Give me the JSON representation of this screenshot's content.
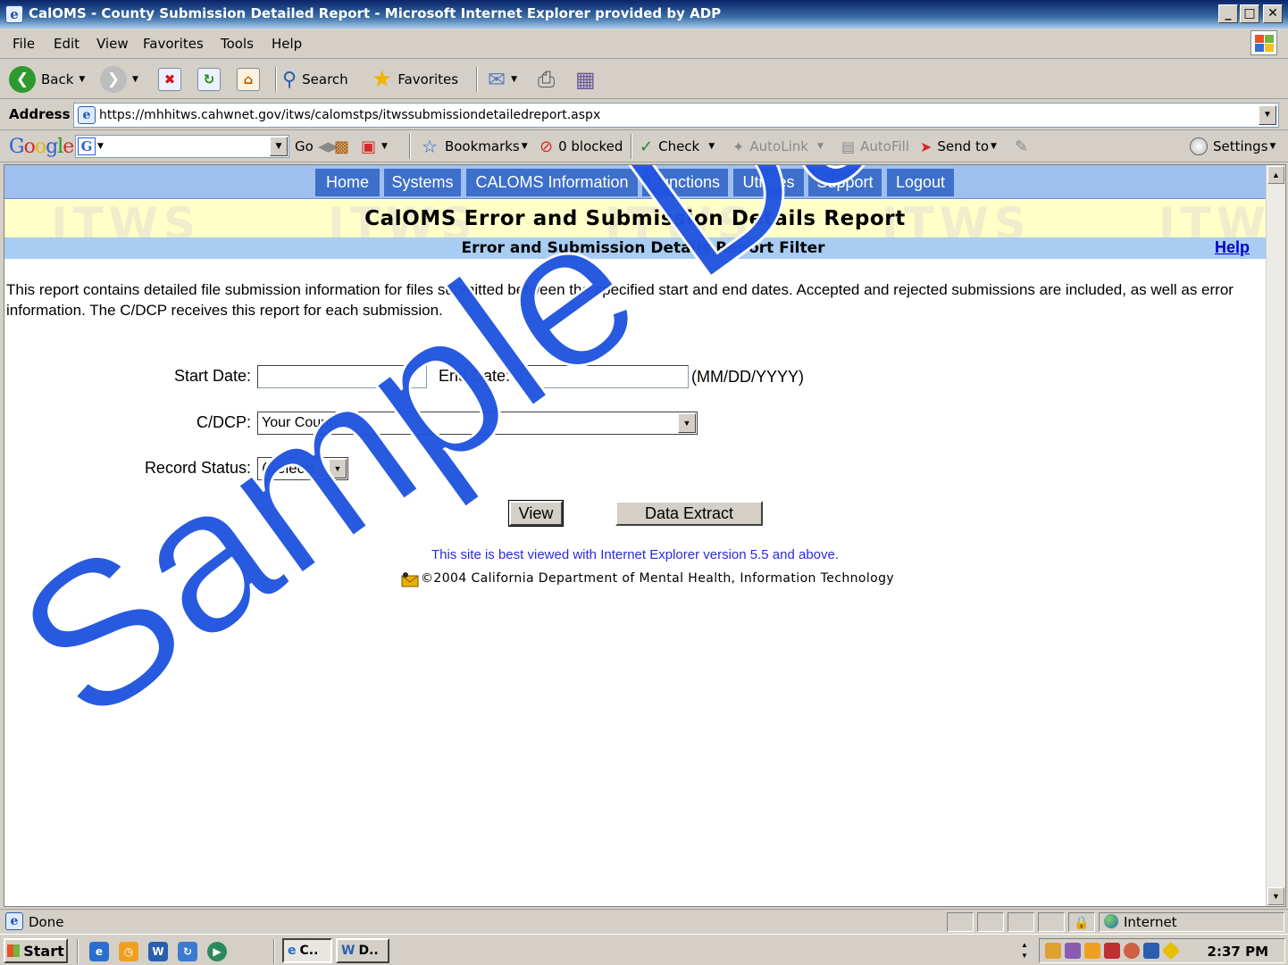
{
  "window": {
    "title": "CalOMS - County Submission Detailed Report - Microsoft Internet Explorer provided by ADP",
    "minimize": "_",
    "maximize": "□",
    "close": "✕"
  },
  "menu": [
    "File",
    "Edit",
    "View",
    "Favorites",
    "Tools",
    "Help"
  ],
  "toolbar": {
    "back": "Back",
    "search": "Search",
    "favorites": "Favorites"
  },
  "address": {
    "label": "Address",
    "url": "https://mhhitws.cahwnet.gov/itws/calomstps/itwssubmissiondetailedreport.aspx"
  },
  "google_toolbar": {
    "go": "Go",
    "bookmarks": "Bookmarks",
    "blocked": "0 blocked",
    "check": "Check",
    "autolink": "AutoLink",
    "autofill": "AutoFill",
    "send_to": "Send to",
    "settings": "Settings"
  },
  "nav": [
    "Home",
    "Systems",
    "CALOMS Information",
    "Functions",
    "Utilities",
    "Support",
    "Logout"
  ],
  "banner_watermark": "ITWS",
  "report": {
    "title": "CalOMS Error and Submission Details Report",
    "filter_title": "Error and Submission Details Report Filter",
    "help": "Help",
    "description": "This report contains detailed file submission information for files submitted between the specified start and end dates.  Accepted and rejected submissions are included, as well as error information.  The C/DCP receives this report for each submission."
  },
  "form": {
    "start_date_label": "Start Date:",
    "start_date_value": "",
    "end_date_label": "End Date:",
    "end_date_value": "",
    "date_format": "(MM/DD/YYYY)",
    "cdcp_label": "C/DCP:",
    "cdcp_value": "Your County",
    "record_status_label": "Record Status:",
    "record_status_value": "(Select)",
    "view_button": "View",
    "extract_button": "Data Extract"
  },
  "footer": {
    "browser_note": "This site is best viewed with Internet Explorer version 5.5 and above.",
    "copyright": "©2004 California Department of Mental Health, Information Technology"
  },
  "overlay_watermark": "Sample Data",
  "status": {
    "text": "Done",
    "zone": "Internet"
  },
  "taskbar": {
    "start": "Start",
    "tasks": [
      "C..",
      "D.."
    ],
    "clock": "2:37 PM"
  },
  "colors": {
    "nav_button": "#3d6fcb",
    "nav_band": "#9fc0ee",
    "title_band": "#ffffc8",
    "filter_band": "#a9ccf2",
    "link": "#0000cc",
    "watermark": "#2255e0"
  }
}
